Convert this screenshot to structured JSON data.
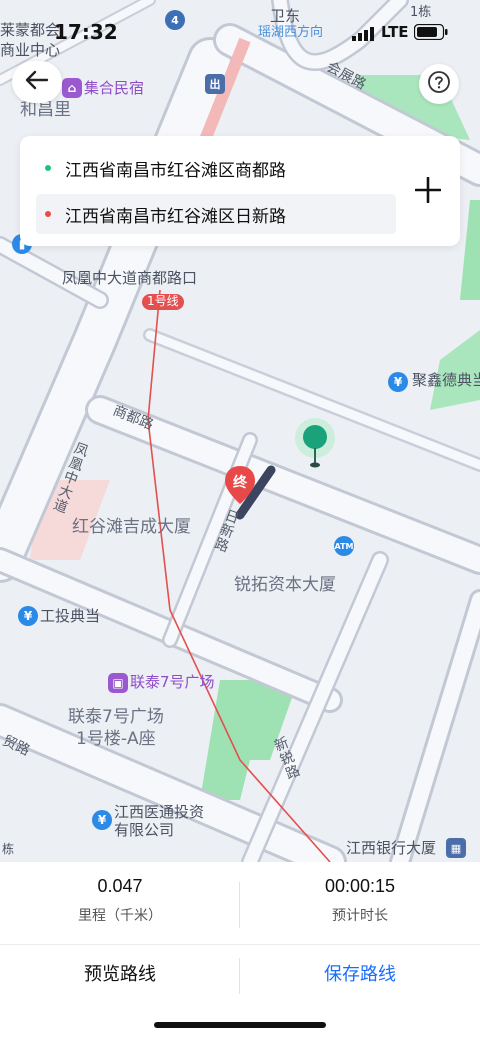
{
  "status_bar": {
    "time": "17:32",
    "network": "LTE"
  },
  "map": {
    "labels": {
      "laimeng": "莱蒙都会",
      "shangye": "商业中心",
      "weidong": "卫东",
      "yaohu": "瑶湖西方向",
      "dong1": "1栋",
      "huizhan": "会展路",
      "jihe": "集合民宿",
      "hechangli": "和昌里",
      "fenghuang_stop": "凤凰中大道商都路口",
      "line1": "1号线",
      "jinxin": "聚鑫德典当",
      "shangdu": "商都路",
      "fenghuang_road": "凤凰中大道",
      "hongguctan": "红谷滩吉成大厦",
      "rixin": "日新路",
      "atm": "ATM",
      "ruituo": "锐拓资本大厦",
      "gongtou": "工投典当",
      "liantai": "联泰7号广场",
      "liantai_a": "联泰7号广场",
      "liantai_a2": "1号楼-A座",
      "mao": "贸路",
      "xinrui": "新锐路",
      "jx_yitong1": "江西医通投资",
      "jx_yitong2": "有限公司",
      "jx_bank": "江西银行大厦",
      "dong": "栋",
      "end_marker": "终",
      "metro_badge": "4"
    }
  },
  "route": {
    "from": "江西省南昌市红谷滩区商都路",
    "to": "江西省南昌市红谷滩区日新路",
    "from_color": "#1ec27a",
    "to_color": "#f04848"
  },
  "summary": {
    "distance_value": "0.047",
    "distance_label": "里程（千米）",
    "duration_value": "00:00:15",
    "duration_label": "预计时长"
  },
  "actions": {
    "preview": "预览路线",
    "save": "保存路线"
  },
  "icons": {
    "back": "arrow-left-icon",
    "help": "question-icon",
    "add": "plus-icon"
  },
  "colors": {
    "accent": "#1a6dff",
    "start_pin": "#1aa37a",
    "end_pin": "#e94848"
  }
}
